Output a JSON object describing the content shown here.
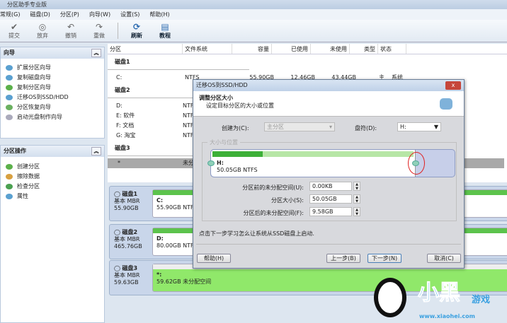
{
  "app": {
    "title": "分区助手专业版"
  },
  "menu": [
    "常规(G)",
    "磁盘(D)",
    "分区(P)",
    "向导(W)",
    "设置(S)",
    "帮助(H)"
  ],
  "toolbar": [
    {
      "label": "提交",
      "icon": "check-icon"
    },
    {
      "label": "放弃",
      "icon": "discard-icon"
    },
    {
      "label": "撤销",
      "icon": "undo-icon"
    },
    {
      "label": "重做",
      "icon": "redo-icon"
    },
    {
      "label": "刷新",
      "icon": "refresh-icon"
    },
    {
      "label": "教程",
      "icon": "tutorial-icon"
    }
  ],
  "wizard_panel": {
    "title": "向导",
    "items": [
      "扩展分区向导",
      "复制磁盘向导",
      "复制分区向导",
      "迁移OS到SSD/HDD",
      "分区恢复向导",
      "启动光盘制作向导"
    ]
  },
  "ops_panel": {
    "title": "分区操作",
    "items": [
      "创建分区",
      "擦除数据",
      "检查分区",
      "属性"
    ]
  },
  "list": {
    "columns": [
      "分区",
      "文件系统",
      "容量",
      "已使用",
      "未使用",
      "类型",
      "状态"
    ],
    "disks": [
      {
        "name": "磁盘1",
        "rows": [
          [
            "C:",
            "NTFS",
            "55.90GB",
            "12.46GB",
            "43.44GB",
            "主",
            "系统"
          ]
        ]
      },
      {
        "name": "磁盘2",
        "rows": [
          [
            "D:",
            "NTFS",
            "",
            "",
            "",
            "",
            ""
          ],
          [
            "E: 软件",
            "NTFS",
            "",
            "",
            "",
            "",
            ""
          ],
          [
            "F: 文档",
            "NTFS",
            "",
            "",
            "",
            "",
            ""
          ],
          [
            "G: 淘宝",
            "NTFS",
            "",
            "",
            "",
            "",
            ""
          ]
        ]
      },
      {
        "name": "磁盘3",
        "rows": [
          [
            "*",
            "未分配",
            "",
            "",
            "",
            "",
            ""
          ]
        ]
      }
    ]
  },
  "disk_map": [
    {
      "name": "磁盘1",
      "type": "基本 MBR",
      "size": "55.90GB",
      "part": "C:",
      "part_info": "55.90GB NTFS"
    },
    {
      "name": "磁盘2",
      "type": "基本 MBR",
      "size": "465.76GB",
      "part": "D:",
      "part_info": "80.00GB NTFS"
    },
    {
      "name": "磁盘3",
      "type": "基本 MBR",
      "size": "59.63GB",
      "part": "*:",
      "part_info": "59.62GB 未分配空间"
    }
  ],
  "dialog": {
    "title": "迁移OS到SSD/HDD",
    "heading": "调整分区大小",
    "subheading": "设定目标分区的大小或位置",
    "create_as_label": "创建为(C):",
    "create_as_value": "主分区",
    "drive_letter_label": "盘符(D):",
    "drive_letter_value": "H:",
    "group_label": "大小与位置",
    "partition_name": "H:",
    "partition_info": "50.05GB NTFS",
    "used_fraction": 0.25,
    "partition_fraction": 0.84,
    "before_label": "分区前的未分配空间(U):",
    "before_value": "0.00KB",
    "size_label": "分区大小(S):",
    "size_value": "50.05GB",
    "after_label": "分区后的未分配空间(F):",
    "after_value": "9.58GB",
    "hint": "点击下一步学习怎么让系统从SSD磁盘上启动.",
    "help": "帮助(H)",
    "back": "上一步(B)",
    "next": "下一步(N)",
    "cancel": "取消(C)",
    "close": "x"
  },
  "watermark": {
    "text": "小黑游戏",
    "url": "www.xiaohei.com"
  },
  "colors": {
    "used": "#5cc34c",
    "free": "#b7e6a6",
    "unallocated": "#90e86a",
    "highlight_circle": "#e02020"
  }
}
